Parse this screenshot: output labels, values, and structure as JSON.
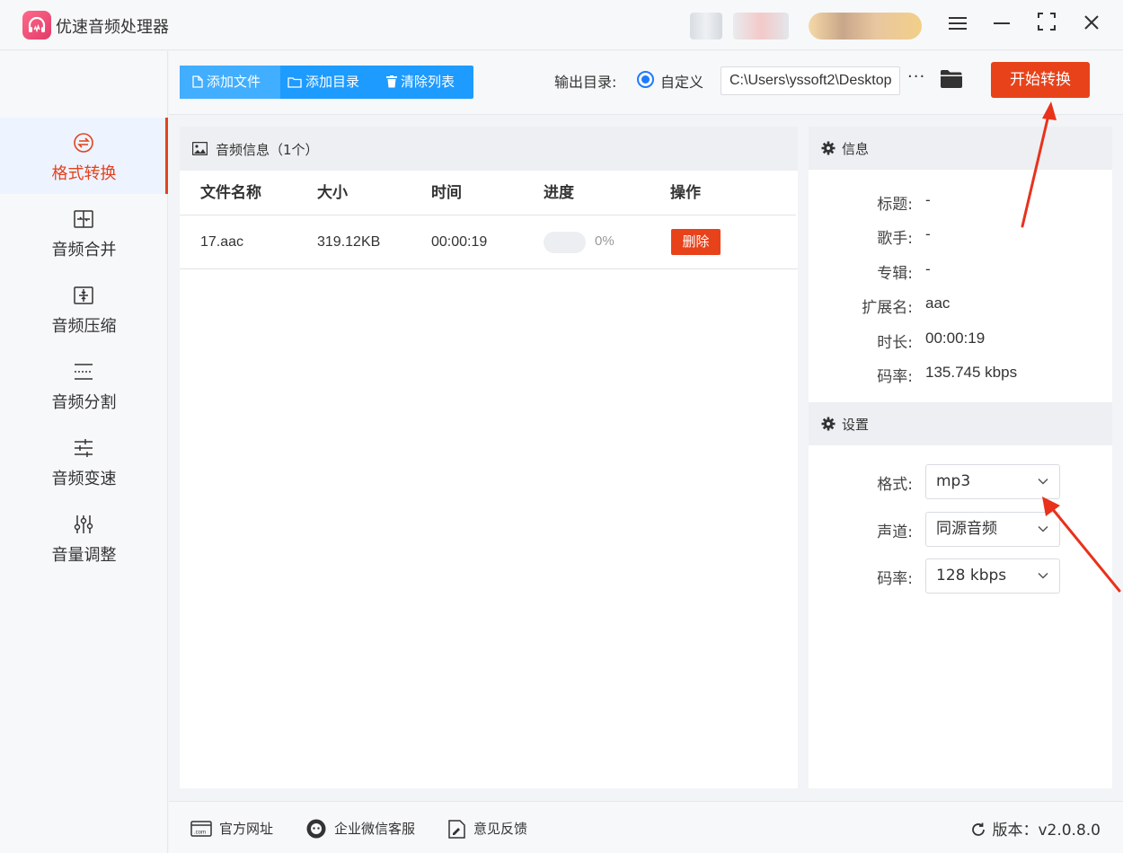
{
  "app": {
    "title": "优速音频处理器",
    "window_controls": [
      "menu-icon",
      "minimize-icon",
      "maximize-icon",
      "close-icon"
    ]
  },
  "sidebar": {
    "items": [
      {
        "label": "格式转换",
        "icon": "format-convert-icon",
        "active": true
      },
      {
        "label": "音频合并",
        "icon": "audio-merge-icon",
        "active": false
      },
      {
        "label": "音频压缩",
        "icon": "audio-compress-icon",
        "active": false
      },
      {
        "label": "音频分割",
        "icon": "audio-split-icon",
        "active": false
      },
      {
        "label": "音频变速",
        "icon": "audio-speed-icon",
        "active": false
      },
      {
        "label": "音量调整",
        "icon": "volume-adjust-icon",
        "active": false
      }
    ]
  },
  "toolbar": {
    "add_file": "添加文件",
    "add_dir": "添加目录",
    "clear_list": "清除列表",
    "output_label": "输出目录:",
    "custom_label": "自定义",
    "output_path": "C:\\Users\\yssoft2\\Desktop",
    "more_label": "···",
    "start_label": "开始转换"
  },
  "file_list": {
    "header": "音频信息（1个）",
    "columns": [
      "文件名称",
      "大小",
      "时间",
      "进度",
      "操作"
    ],
    "rows": [
      {
        "name": "17.aac",
        "size": "319.12KB",
        "time": "00:00:19",
        "progress": 0,
        "progress_text": "0%",
        "action": "删除"
      }
    ]
  },
  "info": {
    "title": "信息",
    "fields": [
      {
        "key": "标题:",
        "value": "-"
      },
      {
        "key": "歌手:",
        "value": "-"
      },
      {
        "key": "专辑:",
        "value": "-"
      },
      {
        "key": "扩展名:",
        "value": "aac"
      },
      {
        "key": "时长:",
        "value": "00:00:19"
      },
      {
        "key": "码率:",
        "value": "135.745 kbps"
      }
    ]
  },
  "settings": {
    "title": "设置",
    "fields": [
      {
        "key": "格式:",
        "value": "mp3"
      },
      {
        "key": "声道:",
        "value": "同源音频"
      },
      {
        "key": "码率:",
        "value": "128 kbps"
      }
    ]
  },
  "footer": {
    "website": "官方网址",
    "wechat": "企业微信客服",
    "feedback": "意见反馈",
    "version": "版本：v2.0.8.0"
  },
  "colors": {
    "accent_red": "#e8421b",
    "accent_blue": "#1e9bff",
    "annotation_arrow": "#e8321b"
  }
}
